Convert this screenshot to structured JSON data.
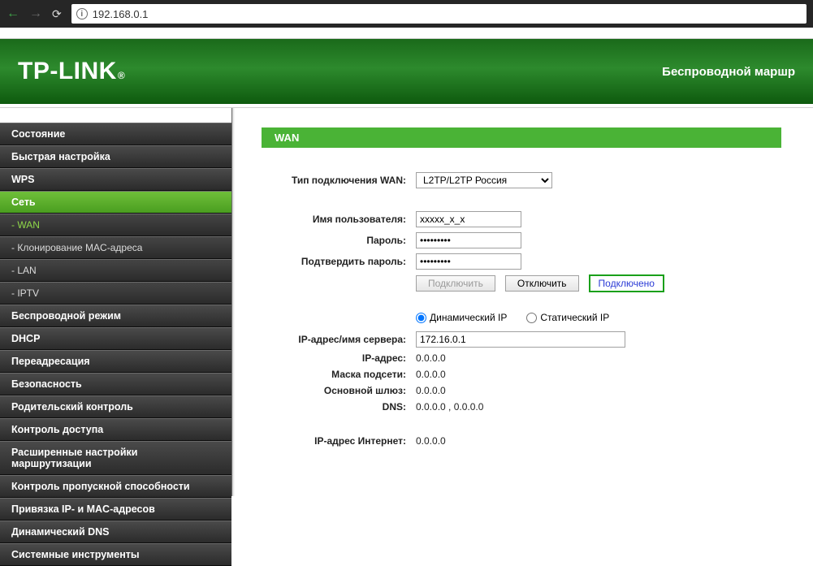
{
  "browser": {
    "url": "192.168.0.1"
  },
  "header": {
    "logo": "TP-LINK",
    "subtitle": "Беспроводной маршр"
  },
  "sidebar": {
    "items": [
      {
        "label": "Состояние",
        "type": "top"
      },
      {
        "label": "Быстрая настройка",
        "type": "top"
      },
      {
        "label": "WPS",
        "type": "top"
      },
      {
        "label": "Сеть",
        "type": "top",
        "selected": true
      },
      {
        "label": "- WAN",
        "type": "sub",
        "selected": true
      },
      {
        "label": "- Клонирование MAC-адреса",
        "type": "sub"
      },
      {
        "label": "- LAN",
        "type": "sub"
      },
      {
        "label": "- IPTV",
        "type": "sub"
      },
      {
        "label": "Беспроводной режим",
        "type": "top"
      },
      {
        "label": "DHCP",
        "type": "top"
      },
      {
        "label": "Переадресация",
        "type": "top"
      },
      {
        "label": "Безопасность",
        "type": "top"
      },
      {
        "label": "Родительский контроль",
        "type": "top"
      },
      {
        "label": "Контроль доступа",
        "type": "top"
      },
      {
        "label": "Расширенные настройки маршрутизации",
        "type": "top"
      },
      {
        "label": "Контроль пропускной способности",
        "type": "top"
      },
      {
        "label": "Привязка IP- и MAC-адресов",
        "type": "top"
      },
      {
        "label": "Динамический DNS",
        "type": "top"
      },
      {
        "label": "Системные инструменты",
        "type": "top"
      }
    ]
  },
  "section": {
    "title": "WAN"
  },
  "form": {
    "conn_type_label": "Тип подключения WAN:",
    "conn_type_value": "L2TP/L2TP Россия",
    "username_label": "Имя пользователя:",
    "username_value": "xxxxx_x_x",
    "password_label": "Пароль:",
    "password_value": "•••••••••",
    "confirm_label": "Подтвердить пароль:",
    "confirm_value": "•••••••••",
    "connect_btn": "Подключить",
    "disconnect_btn": "Отключить",
    "status": "Подключено",
    "dyn_ip_label": "Динамический IP",
    "static_ip_label": "Статический IP",
    "server_label": "IP-адрес/имя сервера:",
    "server_value": "172.16.0.1",
    "ip_label": "IP-адрес:",
    "ip_value": "0.0.0.0",
    "mask_label": "Маска подсети:",
    "mask_value": "0.0.0.0",
    "gateway_label": "Основной шлюз:",
    "gateway_value": "0.0.0.0",
    "dns_label": "DNS:",
    "dns_value": "0.0.0.0 , 0.0.0.0",
    "inet_ip_label": "IP-адрес Интернет:",
    "inet_ip_value": "0.0.0.0"
  }
}
